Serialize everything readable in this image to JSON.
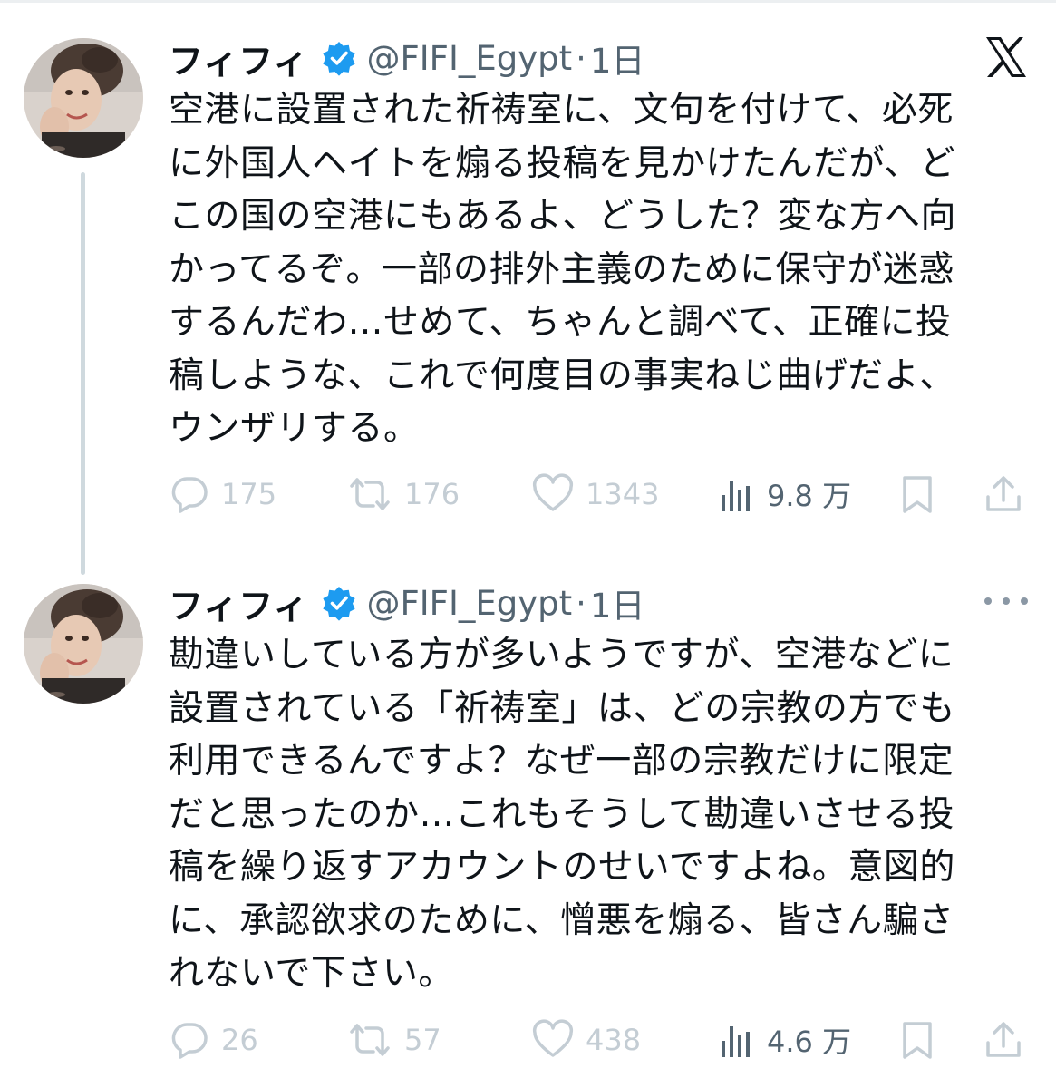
{
  "tweets": [
    {
      "display_name": "フィフィ",
      "handle": "@FIFI_Egypt",
      "separator": "·",
      "time": "1日",
      "lines": [
        "空港に設置された祈祷室に、文句を付けて、必死",
        "に外国人ヘイトを煽る投稿を見かけたんだが、ど",
        "この国の空港にもあるよ、どうした？変な方へ向",
        "かってるぞ。一部の排外主義のために保守が迷惑",
        "するんだわ…せめて、ちゃんと調べて、正確に投",
        "稿しような、これで何度目の事実ねじ曲げだよ、",
        "ウンザリする。"
      ],
      "stats": {
        "replies": "175",
        "retweets": "176",
        "likes": "1343",
        "views": "9.8 万"
      }
    },
    {
      "display_name": "フィフィ",
      "handle": "@FIFI_Egypt",
      "separator": "·",
      "time": "1日",
      "lines": [
        "勘違いしている方が多いようですが、空港などに",
        "設置されている「祈祷室」は、どの宗教の方でも",
        "利用できるんですよ？なぜ一部の宗教だけに限定",
        "だと思ったのか…これもそうして勘違いさせる投",
        "稿を繰り返すアカウントのせいですよね。意図的",
        "に、承認欲求のために、憎悪を煽る、皆さん騙さ",
        "れないで下さい。"
      ],
      "stats": {
        "replies": "26",
        "retweets": "57",
        "likes": "438",
        "views": "4.6 万"
      }
    }
  ],
  "icons": {
    "close": "x-logo-icon",
    "verified": "verified-badge-icon",
    "reply": "reply-icon",
    "retweet": "retweet-icon",
    "like": "heart-icon",
    "views": "views-chart-icon",
    "bookmark": "bookmark-icon",
    "share": "share-icon",
    "more": "more-dots-icon"
  },
  "colors": {
    "verified": "#1d9bf0",
    "text": "#0f1419",
    "secondary": "#536471",
    "faded": "#c4cdd4",
    "thread_line": "#cfd9de"
  }
}
